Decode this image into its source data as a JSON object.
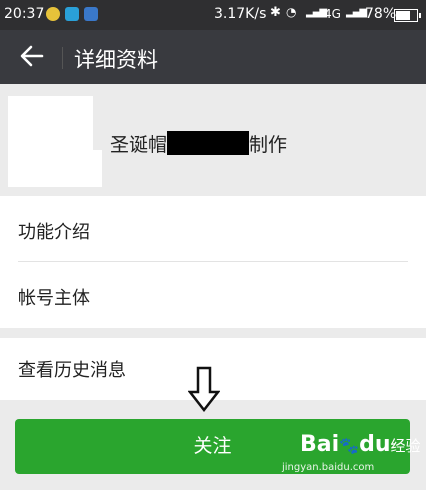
{
  "status_bar": {
    "time": "20:37",
    "speed": "3.17K/s",
    "network": "4G",
    "battery": "78%",
    "battery_level": 0.78
  },
  "title_bar": {
    "back_icon": "arrow-left-icon",
    "title": "详细资料"
  },
  "profile": {
    "name_prefix": "圣诞帽",
    "name_suffix": "制作"
  },
  "rows": [
    {
      "label": "功能介绍"
    },
    {
      "label": "帐号主体"
    },
    {
      "label": "查看历史消息"
    }
  ],
  "follow_button": {
    "label": "关注"
  },
  "watermark": {
    "logo_a": "Bai",
    "logo_b": "du",
    "logo_suffix": "经验",
    "url": "jingyan.baidu.com"
  },
  "colors": {
    "status_bar": "#2f2f31",
    "title_bar": "#393a3f",
    "background": "#ebebeb",
    "accent_green": "#2aa52e"
  }
}
